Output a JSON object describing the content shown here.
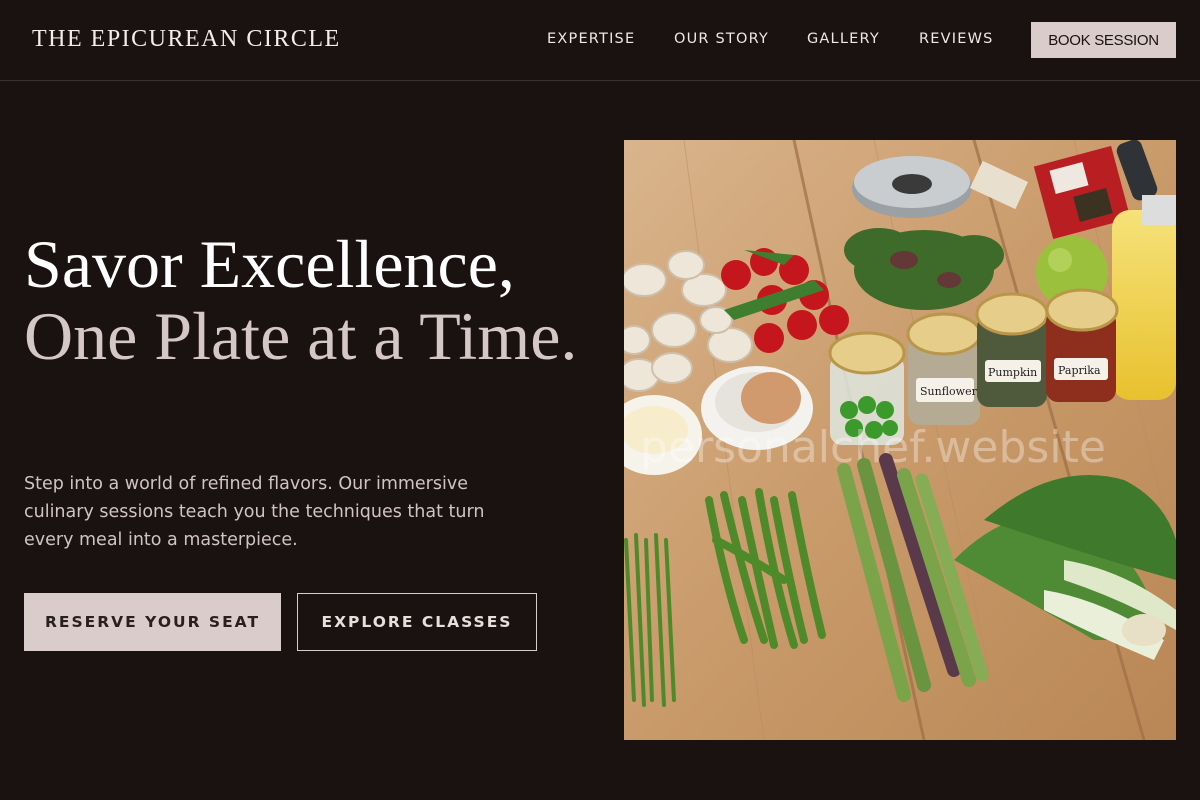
{
  "header": {
    "brand": "THE EPICUREAN CIRCLE",
    "nav": [
      "EXPERTISE",
      "OUR STORY",
      "GALLERY",
      "REVIEWS"
    ],
    "cta_label": "BOOK SESSION"
  },
  "hero": {
    "headline_line1": "Savor Excellence,",
    "headline_line2": "One Plate at a Time.",
    "description": "Step into a world of refined flavors. Our immersive culinary sessions teach you the techniques that turn every meal into a masterpiece.",
    "primary_cta": "RESERVE YOUR SEAT",
    "secondary_cta": "EXPLORE CLASSES",
    "image": {
      "watermark": "personalchef.website",
      "jar_labels": [
        "Sunflower",
        "Pumpkin",
        "Paprika"
      ]
    }
  },
  "colors": {
    "background": "#1a1111",
    "accent": "#d9cccb",
    "text": "#f3ecea",
    "muted_text": "#cfc4c3"
  }
}
